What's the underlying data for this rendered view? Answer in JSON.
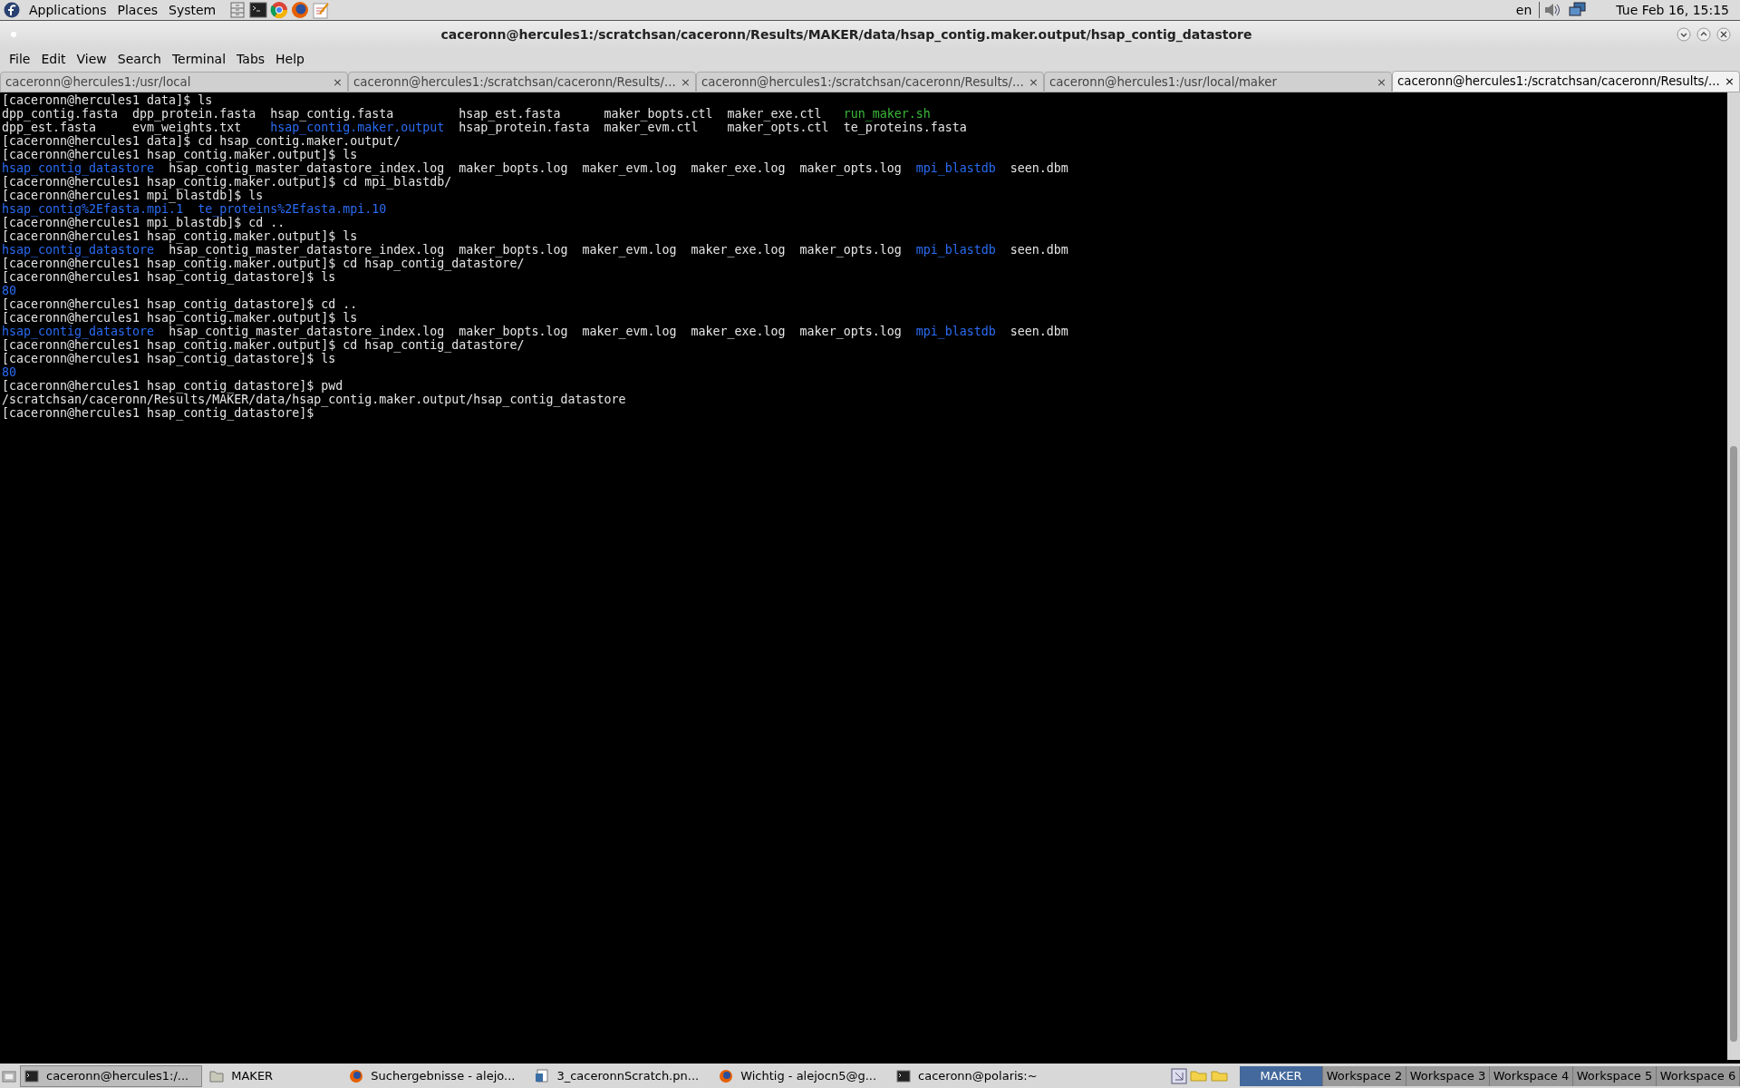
{
  "top_panel": {
    "menus": [
      "Applications",
      "Places",
      "System"
    ],
    "keyboard_layout": "en",
    "clock": "Tue Feb 16, 15:15"
  },
  "window": {
    "title": "caceronn@hercules1:/scratchsan/caceronn/Results/MAKER/data/hsap_contig.maker.output/hsap_contig_datastore"
  },
  "menu_bar": [
    "File",
    "Edit",
    "View",
    "Search",
    "Terminal",
    "Tabs",
    "Help"
  ],
  "tabs": [
    {
      "label": "caceronn@hercules1:/usr/local",
      "close": "×",
      "selected": false
    },
    {
      "label": "caceronn@hercules1:/scratchsan/caceronn/Results/...",
      "close": "×",
      "selected": false
    },
    {
      "label": "caceronn@hercules1:/scratchsan/caceronn/Results/...",
      "close": "×",
      "selected": false
    },
    {
      "label": "caceronn@hercules1:/usr/local/maker",
      "close": "×",
      "selected": false
    },
    {
      "label": "caceronn@hercules1:/scratchsan/caceronn/Results/...",
      "close": "×",
      "selected": true
    }
  ],
  "terminal_lines": [
    [
      {
        "text": "[caceronn@hercules1 data]$ ls",
        "kind": "plain"
      }
    ],
    [
      {
        "text": "dpp_contig.fasta  dpp_protein.fasta  hsap_contig.fasta         hsap_est.fasta      maker_bopts.ctl  maker_exe.ctl   ",
        "kind": "plain"
      },
      {
        "text": "run_maker.sh",
        "kind": "exec"
      }
    ],
    [
      {
        "text": "dpp_est.fasta     evm_weights.txt    ",
        "kind": "plain"
      },
      {
        "text": "hsap_contig.maker.output",
        "kind": "dir"
      },
      {
        "text": "  hsap_protein.fasta  maker_evm.ctl    maker_opts.ctl  te_proteins.fasta",
        "kind": "plain"
      }
    ],
    [
      {
        "text": "[caceronn@hercules1 data]$ cd hsap_contig.maker.output/",
        "kind": "plain"
      }
    ],
    [
      {
        "text": "[caceronn@hercules1 hsap_contig.maker.output]$ ls",
        "kind": "plain"
      }
    ],
    [
      {
        "text": "hsap_contig_datastore",
        "kind": "dir"
      },
      {
        "text": "  hsap_contig_master_datastore_index.log  maker_bopts.log  maker_evm.log  maker_exe.log  maker_opts.log  ",
        "kind": "plain"
      },
      {
        "text": "mpi_blastdb",
        "kind": "dir"
      },
      {
        "text": "  seen.dbm",
        "kind": "plain"
      }
    ],
    [
      {
        "text": "[caceronn@hercules1 hsap_contig.maker.output]$ cd mpi_blastdb/",
        "kind": "plain"
      }
    ],
    [
      {
        "text": "[caceronn@hercules1 mpi_blastdb]$ ls",
        "kind": "plain"
      }
    ],
    [
      {
        "text": "hsap_contig%2Efasta.mpi.1  te_proteins%2Efasta.mpi.10",
        "kind": "dir"
      }
    ],
    [
      {
        "text": "[caceronn@hercules1 mpi_blastdb]$ cd ..",
        "kind": "plain"
      }
    ],
    [
      {
        "text": "[caceronn@hercules1 hsap_contig.maker.output]$ ls",
        "kind": "plain"
      }
    ],
    [
      {
        "text": "hsap_contig_datastore",
        "kind": "dir"
      },
      {
        "text": "  hsap_contig_master_datastore_index.log  maker_bopts.log  maker_evm.log  maker_exe.log  maker_opts.log  ",
        "kind": "plain"
      },
      {
        "text": "mpi_blastdb",
        "kind": "dir"
      },
      {
        "text": "  seen.dbm",
        "kind": "plain"
      }
    ],
    [
      {
        "text": "[caceronn@hercules1 hsap_contig.maker.output]$ cd hsap_contig_datastore/",
        "kind": "plain"
      }
    ],
    [
      {
        "text": "[caceronn@hercules1 hsap_contig_datastore]$ ls",
        "kind": "plain"
      }
    ],
    [
      {
        "text": "80",
        "kind": "dir"
      }
    ],
    [
      {
        "text": "[caceronn@hercules1 hsap_contig_datastore]$ cd ..",
        "kind": "plain"
      }
    ],
    [
      {
        "text": "[caceronn@hercules1 hsap_contig.maker.output]$ ls",
        "kind": "plain"
      }
    ],
    [
      {
        "text": "hsap_contig_datastore",
        "kind": "dir"
      },
      {
        "text": "  hsap_contig_master_datastore_index.log  maker_bopts.log  maker_evm.log  maker_exe.log  maker_opts.log  ",
        "kind": "plain"
      },
      {
        "text": "mpi_blastdb",
        "kind": "dir"
      },
      {
        "text": "  seen.dbm",
        "kind": "plain"
      }
    ],
    [
      {
        "text": "[caceronn@hercules1 hsap_contig.maker.output]$ cd hsap_contig_datastore/",
        "kind": "plain"
      }
    ],
    [
      {
        "text": "[caceronn@hercules1 hsap_contig_datastore]$ ls",
        "kind": "plain"
      }
    ],
    [
      {
        "text": "80",
        "kind": "dir"
      }
    ],
    [
      {
        "text": "[caceronn@hercules1 hsap_contig_datastore]$ pwd",
        "kind": "plain"
      }
    ],
    [
      {
        "text": "/scratchsan/caceronn/Results/MAKER/data/hsap_contig.maker.output/hsap_contig_datastore",
        "kind": "plain"
      }
    ],
    [
      {
        "text": "[caceronn@hercules1 hsap_contig_datastore]$",
        "kind": "plain"
      }
    ]
  ],
  "taskbar": [
    {
      "label": "caceronn@hercules1:/...",
      "kind": "terminal",
      "selected": true
    },
    {
      "label": "MAKER",
      "kind": "folder",
      "selected": false
    },
    {
      "label": "Suchergebnisse - alejo...",
      "kind": "browser",
      "selected": false
    },
    {
      "label": "3_caceronnScratch.pn...",
      "kind": "image",
      "selected": false
    },
    {
      "label": "Wichtig - alejocn5@g...",
      "kind": "browser",
      "selected": false
    },
    {
      "label": "caceronn@polaris:~",
      "kind": "terminal",
      "selected": false
    }
  ],
  "workspaces": [
    {
      "label": "MAKER",
      "selected": true
    },
    {
      "label": "Workspace 2",
      "selected": false
    },
    {
      "label": "Workspace 3",
      "selected": false
    },
    {
      "label": "Workspace 4",
      "selected": false
    },
    {
      "label": "Workspace 5",
      "selected": false
    },
    {
      "label": "Workspace 6",
      "selected": false
    }
  ]
}
